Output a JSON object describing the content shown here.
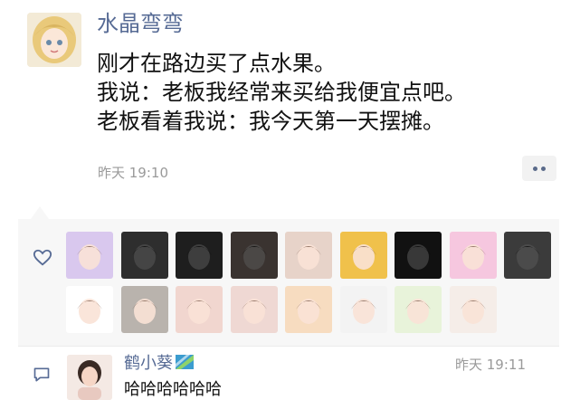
{
  "post": {
    "username": "水晶弯弯",
    "lines": [
      "刚才在路边买了点水果。",
      "我说：老板我经常来买给我便宜点吧。",
      "老板看着我说：我今天第一天摆摊。"
    ],
    "time": "昨天 19:10"
  },
  "likes": {
    "icon": "heart-icon",
    "avatars": [
      {
        "name": "anime-girl-purple",
        "color": "#d9c8ee"
      },
      {
        "name": "dark-room-photo",
        "color": "#2e2e2e"
      },
      {
        "name": "girl-dark-hair",
        "color": "#1e1e1e"
      },
      {
        "name": "anime-boy-blonde",
        "color": "#3a3330"
      },
      {
        "name": "girl-red-bow",
        "color": "#e7d3c9"
      },
      {
        "name": "man-yellow-bg",
        "color": "#f0c14b"
      },
      {
        "name": "black-cat",
        "color": "#111111"
      },
      {
        "name": "anime-girl-pink",
        "color": "#f6c7df"
      },
      {
        "name": "dark-selfie",
        "color": "#3b3b3b"
      },
      {
        "name": "cartoon-bear-white",
        "color": "#ffffff"
      },
      {
        "name": "grey-cat",
        "color": "#b9b3ad"
      },
      {
        "name": "girl-black-hair-red",
        "color": "#f1d6cf"
      },
      {
        "name": "cartoon-girl-pink",
        "color": "#efd8d3"
      },
      {
        "name": "bear-cookie",
        "color": "#f7dcc0"
      },
      {
        "name": "cartoon-girl-bob",
        "color": "#f3f3f3"
      },
      {
        "name": "chick-yellow-hat",
        "color": "#e8f3da"
      },
      {
        "name": "devil-cartoon",
        "color": "#f5ede8"
      }
    ]
  },
  "comment": {
    "icon": "comment-icon",
    "username": "鹤小葵",
    "time": "昨天 19:11",
    "text": "哈哈哈哈哈哈"
  },
  "colors": {
    "link": "#576b95",
    "panel": "#f7f7f7",
    "muted": "#9a9a9a"
  }
}
